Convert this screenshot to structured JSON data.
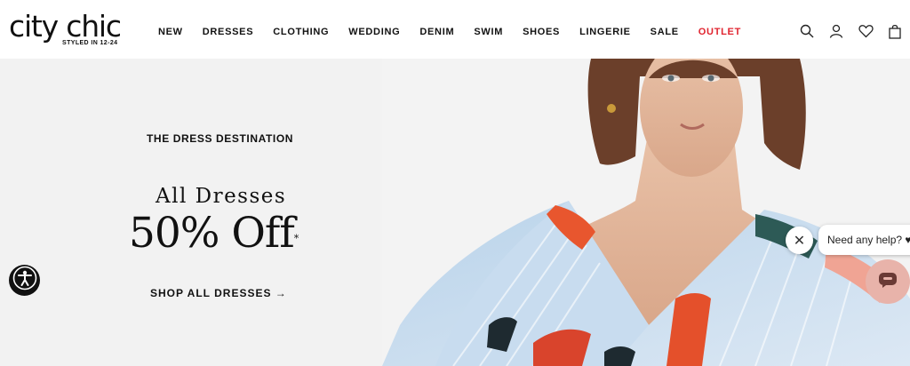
{
  "brand": {
    "name": "city chic",
    "tagline": "STYLED IN 12-24"
  },
  "nav": {
    "items": [
      "NEW",
      "DRESSES",
      "CLOTHING",
      "WEDDING",
      "DENIM",
      "SWIM",
      "SHOES",
      "LINGERIE",
      "SALE",
      "OUTLET"
    ],
    "highlight_color": "#e0242f"
  },
  "header_icons": [
    "search-icon",
    "account-icon",
    "wishlist-heart-icon",
    "bag-icon"
  ],
  "hero": {
    "eyebrow": "THE DRESS DESTINATION",
    "headline_line1": "All Dresses",
    "headline_line2": "50% Off",
    "headline_mark": "*",
    "cta": "SHOP ALL DRESSES →"
  },
  "chat": {
    "close_symbol": "✕",
    "prompt": "Need any help? ♥",
    "launcher_color": "#e8b3aa"
  },
  "accessibility": {
    "icon": "accessibility-icon"
  }
}
